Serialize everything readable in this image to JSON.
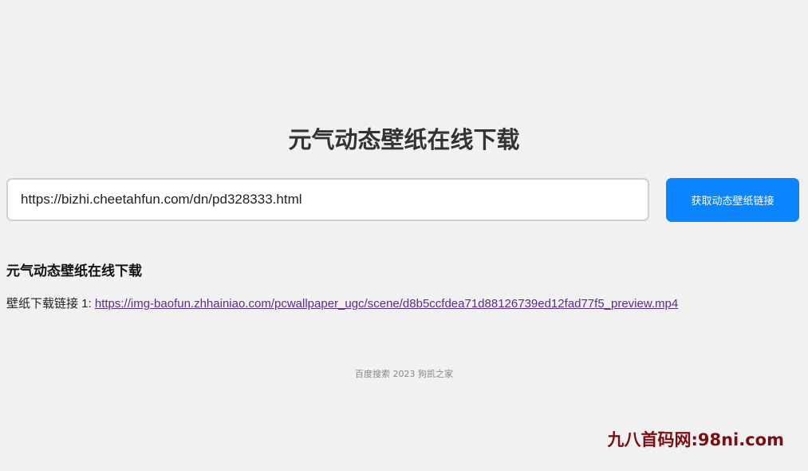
{
  "page": {
    "title": "元气动态壁纸在线下载"
  },
  "form": {
    "url_value": "https://bizhi.cheetahfun.com/dn/pd328333.html",
    "button_label": "获取动态壁纸链接"
  },
  "result": {
    "heading": "元气动态壁纸在线下载",
    "link_label": "壁纸下载链接 1: ",
    "link_url": "https://img-baofun.zhhainiao.com/pcwallpaper_ugc/scene/d8b5ccfdea71d88126739ed12fad77f5_preview.mp4"
  },
  "footer": {
    "text": "百度搜索 2023 狗凯之家"
  },
  "watermark": {
    "text": "九八首码网:98ni.com"
  },
  "colors": {
    "background": "#f1f1f1",
    "button": "#0a84ff",
    "link": "#5a2d8c",
    "watermark": "#7a0f12"
  }
}
